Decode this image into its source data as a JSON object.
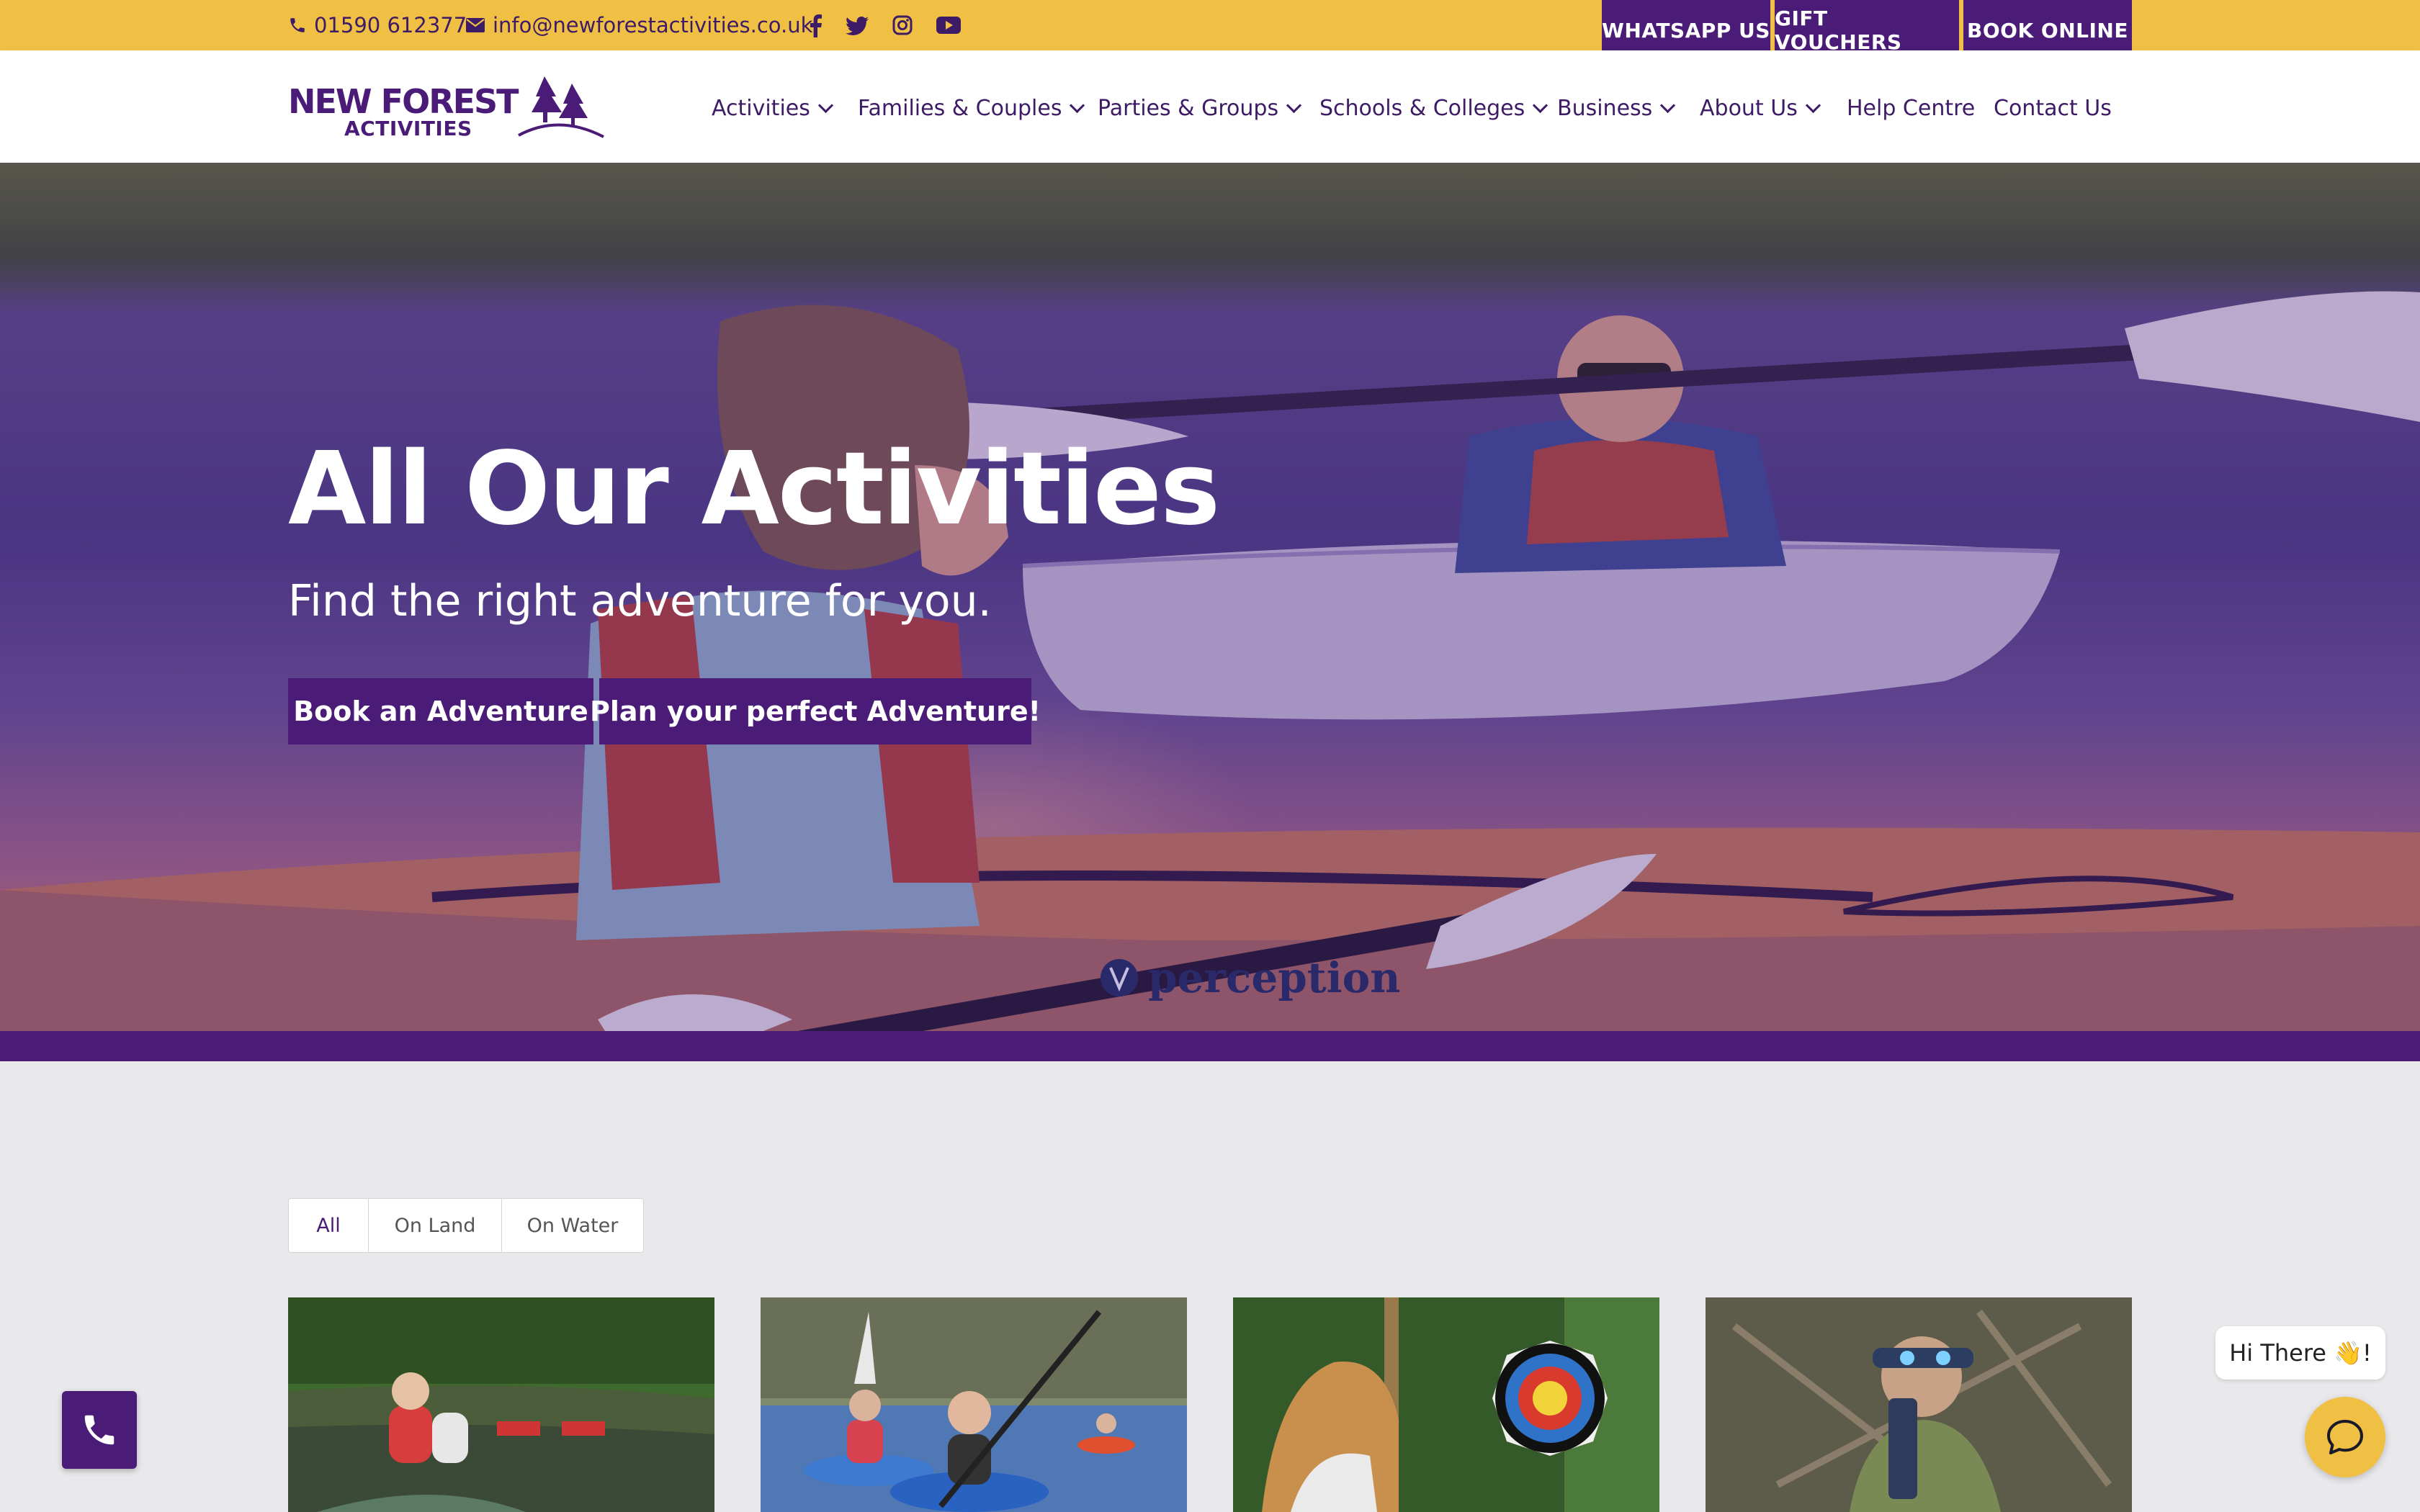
{
  "topbar": {
    "phone": "01590 612377",
    "email": "info@newforestactivities.co.uk",
    "social_icons": [
      "facebook-icon",
      "twitter-icon",
      "instagram-icon",
      "youtube-icon"
    ],
    "buttons": [
      "WHATSAPP US",
      "GIFT VOUCHERS",
      "BOOK ONLINE"
    ]
  },
  "logo": {
    "main": "NEW FOREST",
    "sub": "ACTIVITIES"
  },
  "nav": {
    "items": [
      {
        "label": "Activities",
        "dropdown": true
      },
      {
        "label": "Families & Couples",
        "dropdown": true
      },
      {
        "label": "Parties & Groups",
        "dropdown": true
      },
      {
        "label": "Schools & Colleges",
        "dropdown": true
      },
      {
        "label": "Business",
        "dropdown": true
      },
      {
        "label": "About Us",
        "dropdown": true
      },
      {
        "label": "Help Centre",
        "dropdown": false
      },
      {
        "label": "Contact Us",
        "dropdown": false
      }
    ]
  },
  "hero": {
    "title": "All Our Activities",
    "subtitle": "Find the right adventure for you.",
    "buttons": [
      "Book an Adventure",
      "Plan your perfect Adventure!"
    ],
    "image_text": "perception"
  },
  "filters": {
    "tabs": [
      "All",
      "On Land",
      "On Water"
    ],
    "active": "All"
  },
  "chat": {
    "greeting": "Hi There 👋!"
  },
  "colors": {
    "brand_purple": "#4a1c78",
    "brand_yellow": "#f0c044",
    "page_bg": "#e9e8ea"
  }
}
